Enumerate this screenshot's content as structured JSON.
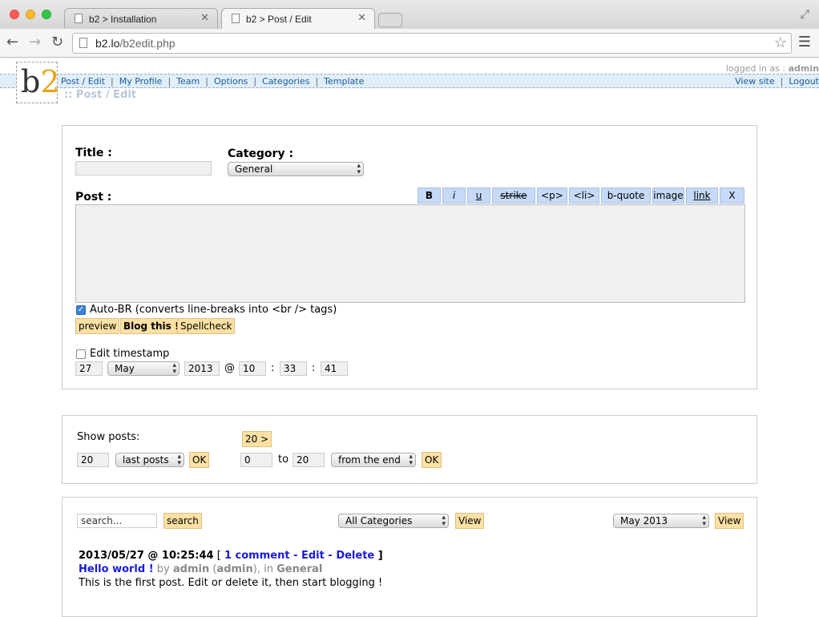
{
  "browser": {
    "tabs": [
      {
        "label": "b2 > Installation"
      },
      {
        "label": "b2 > Post / Edit"
      }
    ],
    "url_host": "b2.lo",
    "url_path": "/b2edit.php"
  },
  "header": {
    "logo_b": "b",
    "logo_2": "2",
    "logged_in_label": "logged in as :",
    "logged_in_user": "admin",
    "nav": [
      "Post / Edit",
      "My Profile",
      "Team",
      "Options",
      "Categories",
      "Template"
    ],
    "nav_right": [
      "View site",
      "Logout"
    ],
    "breadcrumb": ":: Post / Edit"
  },
  "edit": {
    "title_label": "Title :",
    "category_label": "Category :",
    "category_value": "General",
    "post_label": "Post :",
    "quicktags": [
      "B",
      "i",
      "u",
      "strike",
      "<p>",
      "<li>",
      "b-quote",
      "image",
      "link",
      "X"
    ],
    "autobr_label": "Auto-BR (converts line-breaks into <br /> tags)",
    "buttons": {
      "preview": "preview",
      "blog": "Blog this !",
      "spellcheck": "Spellcheck"
    },
    "timestamp_label": "Edit timestamp",
    "timestamp": {
      "day": "27",
      "month": "May",
      "year": "2013",
      "at": "@",
      "hour": "10",
      "minute": "33",
      "second": "41",
      "colon": ":"
    }
  },
  "show": {
    "label": "Show posts:",
    "count": "20",
    "mode": "last posts",
    "ok": "OK",
    "next": "20 >",
    "from": "0",
    "to_label": "to",
    "to": "20",
    "order": "from the end",
    "ok2": "OK"
  },
  "list": {
    "search_placeholder": "search...",
    "search_button": "search",
    "category_filter": "All Categories",
    "view_button": "View",
    "month_filter": "May 2013",
    "view_button2": "View",
    "post": {
      "date": "2013/05/27 @ 10:25:44",
      "comments": "1 comment",
      "edit": "Edit",
      "delete": "Delete",
      "title": "Hello world !",
      "by": "by",
      "author": "admin",
      "author_login": "admin",
      "in": "in",
      "category": "General",
      "excerpt": "This is the first post. Edit or delete it, then start blogging !"
    }
  }
}
